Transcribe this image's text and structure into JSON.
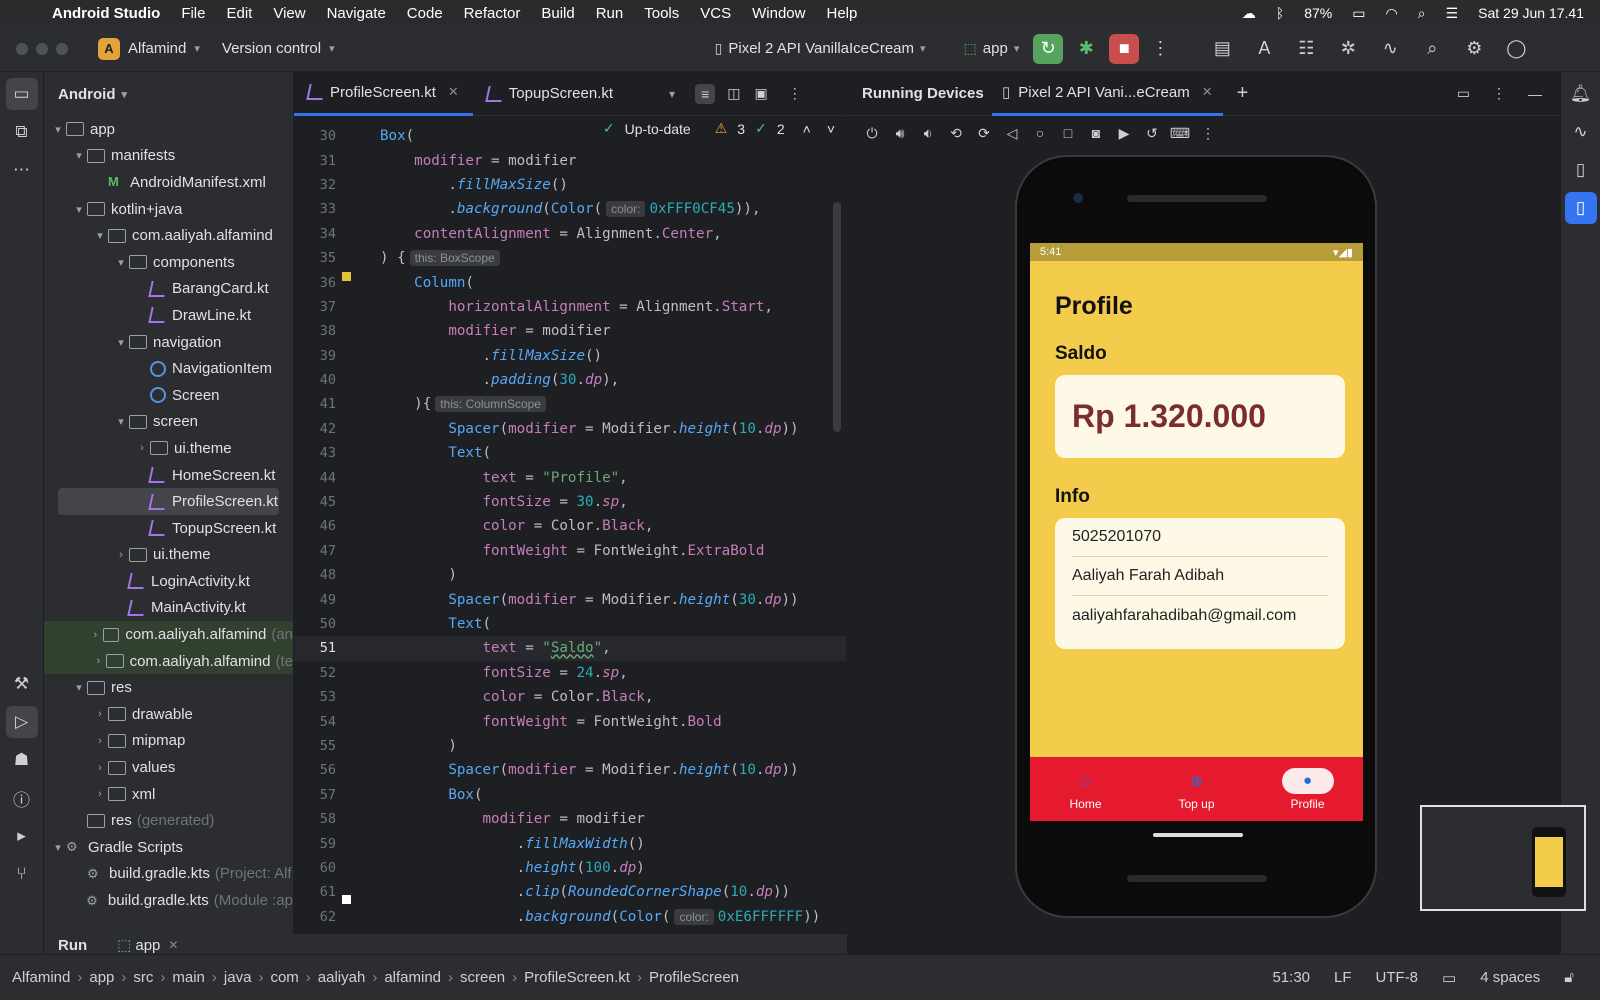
{
  "menubar": {
    "app": "Android Studio",
    "items": [
      "File",
      "Edit",
      "View",
      "Navigate",
      "Code",
      "Refactor",
      "Build",
      "Run",
      "Tools",
      "VCS",
      "Window",
      "Help"
    ],
    "battery": "87%",
    "datetime": "Sat 29 Jun  17.41"
  },
  "toolbar": {
    "project_badge": "A",
    "project": "Alfamind",
    "vcs": "Version control",
    "device": "Pixel 2 API VanillaIceCream",
    "run_config": "app"
  },
  "project_panel": {
    "title": "Android",
    "rows": [
      {
        "label": "app",
        "extra": "",
        "indent": 0,
        "arrow": "▾",
        "icon": "folder"
      },
      {
        "label": "manifests",
        "extra": "",
        "indent": 1,
        "arrow": "▾",
        "icon": "folder"
      },
      {
        "label": "AndroidManifest.xml",
        "extra": "",
        "indent": 2,
        "arrow": "",
        "icon": "manifest"
      },
      {
        "label": "kotlin+java",
        "extra": "",
        "indent": 1,
        "arrow": "▾",
        "icon": "folder"
      },
      {
        "label": "com.aaliyah.alfamind",
        "extra": "",
        "indent": 2,
        "arrow": "▾",
        "icon": "folder"
      },
      {
        "label": "components",
        "extra": "",
        "indent": 3,
        "arrow": "▾",
        "icon": "folder"
      },
      {
        "label": "BarangCard.kt",
        "extra": "",
        "indent": 4,
        "arrow": "",
        "icon": "kotlin"
      },
      {
        "label": "DrawLine.kt",
        "extra": "",
        "indent": 4,
        "arrow": "",
        "icon": "kotlin"
      },
      {
        "label": "navigation",
        "extra": "",
        "indent": 3,
        "arrow": "▾",
        "icon": "folder"
      },
      {
        "label": "NavigationItem",
        "extra": "",
        "indent": 4,
        "arrow": "",
        "icon": "class"
      },
      {
        "label": "Screen",
        "extra": "",
        "indent": 4,
        "arrow": "",
        "icon": "class"
      },
      {
        "label": "screen",
        "extra": "",
        "indent": 3,
        "arrow": "▾",
        "icon": "folder"
      },
      {
        "label": "ui.theme",
        "extra": "",
        "indent": 4,
        "arrow": "›",
        "icon": "folder"
      },
      {
        "label": "HomeScreen.kt",
        "extra": "",
        "indent": 4,
        "arrow": "",
        "icon": "kotlin"
      },
      {
        "label": "ProfileScreen.kt",
        "extra": "",
        "indent": 4,
        "arrow": "",
        "icon": "kotlin",
        "selected": true
      },
      {
        "label": "TopupScreen.kt",
        "extra": "",
        "indent": 4,
        "arrow": "",
        "icon": "kotlin"
      },
      {
        "label": "ui.theme",
        "extra": "",
        "indent": 3,
        "arrow": "›",
        "icon": "folder"
      },
      {
        "label": "LoginActivity.kt",
        "extra": "",
        "indent": 3,
        "arrow": "",
        "icon": "kotlin"
      },
      {
        "label": "MainActivity.kt",
        "extra": "",
        "indent": 3,
        "arrow": "",
        "icon": "kotlin"
      },
      {
        "label": "com.aaliyah.alfamind",
        "extra": "(an",
        "indent": 2,
        "arrow": "›",
        "icon": "folder",
        "hl": true
      },
      {
        "label": "com.aaliyah.alfamind",
        "extra": "(te",
        "indent": 2,
        "arrow": "›",
        "icon": "folder",
        "hl": true
      },
      {
        "label": "res",
        "extra": "",
        "indent": 1,
        "arrow": "▾",
        "icon": "folder"
      },
      {
        "label": "drawable",
        "extra": "",
        "indent": 2,
        "arrow": "›",
        "icon": "folder"
      },
      {
        "label": "mipmap",
        "extra": "",
        "indent": 2,
        "arrow": "›",
        "icon": "folder"
      },
      {
        "label": "values",
        "extra": "",
        "indent": 2,
        "arrow": "›",
        "icon": "folder"
      },
      {
        "label": "xml",
        "extra": "",
        "indent": 2,
        "arrow": "›",
        "icon": "folder"
      },
      {
        "label": "res",
        "extra": "(generated)",
        "indent": 1,
        "arrow": "",
        "icon": "folder"
      },
      {
        "label": "Gradle Scripts",
        "extra": "",
        "indent": 0,
        "arrow": "▾",
        "icon": "gradle"
      },
      {
        "label": "build.gradle.kts",
        "extra": "(Project: Alf",
        "indent": 1,
        "arrow": "",
        "icon": "gradle"
      },
      {
        "label": "build.gradle.kts",
        "extra": "(Module :ap",
        "indent": 1,
        "arrow": "",
        "icon": "gradle"
      }
    ]
  },
  "editor": {
    "tabs": [
      "ProfileScreen.kt",
      "TopupScreen.kt"
    ],
    "status": "Up-to-date",
    "warnings": "3",
    "weak_warnings": "2",
    "lines": [
      {
        "n": "30",
        "html": "<span class='fn'>Box</span>("
      },
      {
        "n": "31",
        "html": "    <span class='prop'>modifier</span> = modifier"
      },
      {
        "n": "32",
        "html": "        .<span class='ital'>fillMaxSize</span>()"
      },
      {
        "n": "33",
        "html": "        .<span class='ital'>background</span>(<span class='fn'>Color</span>(<span class='hint'>color:</span><span class='num'>0xFFF0CF45</span>)),"
      },
      {
        "n": "34",
        "html": "    <span class='prop'>contentAlignment</span> = Alignment.<span class='prop'>Center</span>,"
      },
      {
        "n": "35",
        "html": ") {<span class='hint'>this: BoxScope</span>"
      },
      {
        "n": "36",
        "html": "    <span class='fn'>Column</span>("
      },
      {
        "n": "37",
        "html": "        <span class='prop'>horizontalAlignment</span> = Alignment.<span class='prop'>Start</span>,"
      },
      {
        "n": "38",
        "html": "        <span class='prop'>modifier</span> = modifier"
      },
      {
        "n": "39",
        "html": "            .<span class='ital'>fillMaxSize</span>()"
      },
      {
        "n": "40",
        "html": "            .<span class='ital'>padding</span>(<span class='num'>30</span>.<span class='sp'>dp</span>),"
      },
      {
        "n": "41",
        "html": "    ){<span class='hint'>this: ColumnScope</span>"
      },
      {
        "n": "42",
        "html": "        <span class='fn'>Spacer</span>(<span class='prop'>modifier</span> = Modifier.<span class='ital'>height</span>(<span class='num'>10</span>.<span class='sp'>dp</span>))"
      },
      {
        "n": "43",
        "html": "        <span class='fn'>Text</span>("
      },
      {
        "n": "44",
        "html": "            <span class='prop'>text</span> = <span class='str'>\"Profile\"</span>,"
      },
      {
        "n": "45",
        "html": "            <span class='prop'>fontSize</span> = <span class='num'>30</span>.<span class='sp'>sp</span>,"
      },
      {
        "n": "46",
        "html": "            <span class='prop'>color</span> = Color.<span class='prop'>Black</span>,"
      },
      {
        "n": "47",
        "html": "            <span class='prop'>fontWeight</span> = FontWeight.<span class='prop'>ExtraBold</span>"
      },
      {
        "n": "48",
        "html": "        )"
      },
      {
        "n": "49",
        "html": "        <span class='fn'>Spacer</span>(<span class='prop'>modifier</span> = Modifier.<span class='ital'>height</span>(<span class='num'>30</span>.<span class='sp'>dp</span>))"
      },
      {
        "n": "50",
        "html": "        <span class='fn'>Text</span>("
      },
      {
        "n": "51",
        "html": "            <span class='prop'>text</span> = <span class='str'>\"<span class='sq'>Saldo</span>\"</span>,",
        "cur": true
      },
      {
        "n": "52",
        "html": "            <span class='prop'>fontSize</span> = <span class='num'>24</span>.<span class='sp'>sp</span>,"
      },
      {
        "n": "53",
        "html": "            <span class='prop'>color</span> = Color.<span class='prop'>Black</span>,"
      },
      {
        "n": "54",
        "html": "            <span class='prop'>fontWeight</span> = FontWeight.<span class='prop'>Bold</span>"
      },
      {
        "n": "55",
        "html": "        )"
      },
      {
        "n": "56",
        "html": "        <span class='fn'>Spacer</span>(<span class='prop'>modifier</span> = Modifier.<span class='ital'>height</span>(<span class='num'>10</span>.<span class='sp'>dp</span>))"
      },
      {
        "n": "57",
        "html": "        <span class='fn'>Box</span>("
      },
      {
        "n": "58",
        "html": "            <span class='prop'>modifier</span> = modifier"
      },
      {
        "n": "59",
        "html": "                .<span class='ital'>fillMaxWidth</span>()"
      },
      {
        "n": "60",
        "html": "                .<span class='ital'>height</span>(<span class='num'>100</span>.<span class='sp'>dp</span>)"
      },
      {
        "n": "61",
        "html": "                .<span class='ital'>clip</span>(<span class='ital'>RoundedCornerShape</span>(<span class='num'>10</span>.<span class='sp'>dp</span>))"
      },
      {
        "n": "62",
        "html": "                .<span class='ital'>background</span>(<span class='fn'>Color</span>(<span class='hint'>color:</span><span class='num'>0xE6FFFFFF</span>))"
      }
    ]
  },
  "running": {
    "title": "Running Devices",
    "tab": "Pixel 2 API Vani...eCream"
  },
  "app": {
    "time": "5:41",
    "title": "Profile",
    "saldo_label": "Saldo",
    "saldo": "Rp 1.320.000",
    "info_label": "Info",
    "info": [
      "5025201070",
      "Aaliyah Farah Adibah",
      "aaliyahfarahadibah@gmail.com"
    ],
    "nav": [
      {
        "label": "Home",
        "icon": "⌂",
        "active": false
      },
      {
        "label": "Top up",
        "icon": "⊕",
        "active": false
      },
      {
        "label": "Profile",
        "icon": "●",
        "active": true
      }
    ]
  },
  "runbar": {
    "label": "Run",
    "config": "app"
  },
  "statusbar": {
    "crumbs": [
      "Alfamind",
      "app",
      "src",
      "main",
      "java",
      "com",
      "aaliyah",
      "alfamind",
      "screen",
      "ProfileScreen.kt",
      "ProfileScreen"
    ],
    "position": "51:30",
    "line_sep": "LF",
    "encoding": "UTF-8",
    "indent": "4 spaces"
  },
  "colors": {
    "app_bg": "#F0CF45",
    "nav_red": "#E51A2E",
    "saldo_text": "#7A2D2A",
    "accent": "#3574F0"
  }
}
